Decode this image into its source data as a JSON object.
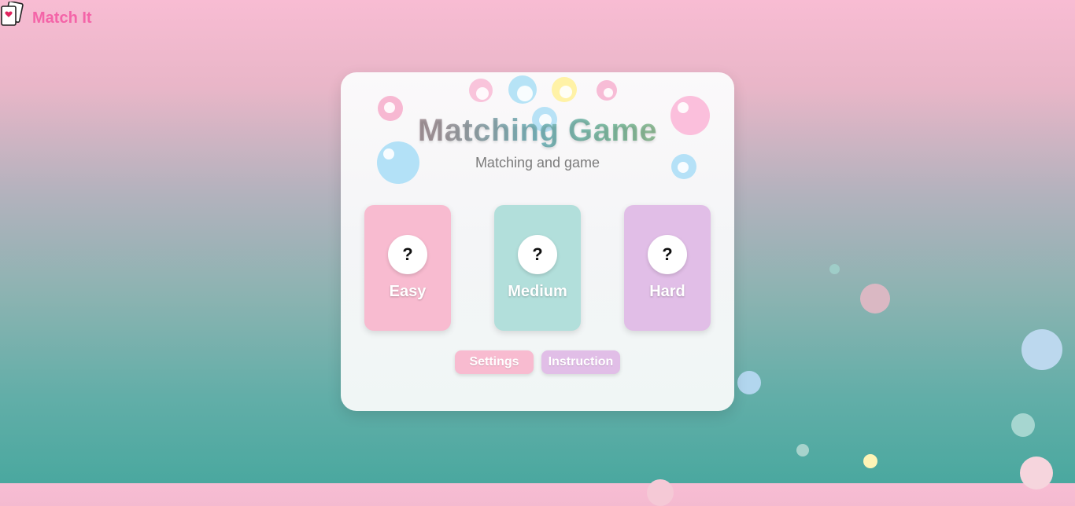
{
  "app": {
    "title": "Match It",
    "logo_icon": "playing-cards-icon"
  },
  "game": {
    "title": "Matching Game",
    "subtitle": "Matching and game"
  },
  "levels": [
    {
      "label": "Easy",
      "symbol": "?",
      "color": "#f8bbd0"
    },
    {
      "label": "Medium",
      "symbol": "?",
      "color": "#b2dfdb"
    },
    {
      "label": "Hard",
      "symbol": "?",
      "color": "#e1bee7"
    }
  ],
  "buttons": {
    "settings": "Settings",
    "instruction": "Instruction"
  },
  "colors": {
    "accent_pink": "#f464a8",
    "pink": "#f8bbd0",
    "mint": "#b2dfdb",
    "lavender": "#e1bee7",
    "blue": "#b3e0f7",
    "yellow": "#fff5a8"
  }
}
